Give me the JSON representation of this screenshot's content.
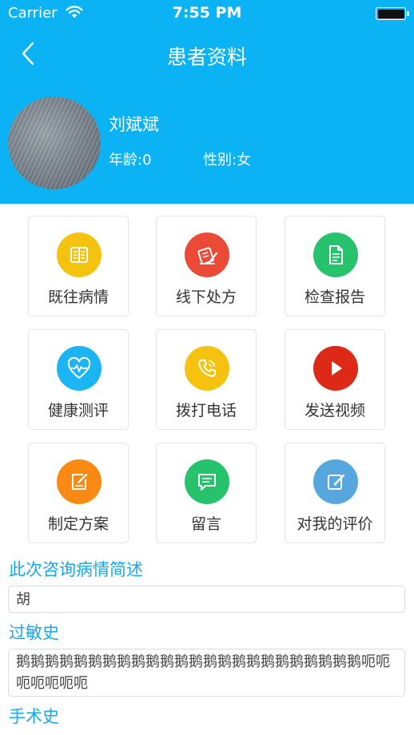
{
  "status_bar": {
    "carrier": "Carrier",
    "time": "7:55 PM"
  },
  "nav": {
    "title": "患者资料"
  },
  "patient": {
    "name": "刘斌斌",
    "age": "年龄:0",
    "gender": "性别:女"
  },
  "menu": [
    {
      "label": "既往病情",
      "icon": "book-icon",
      "color": "#f5c20f"
    },
    {
      "label": "线下处方",
      "icon": "prescription-icon",
      "color": "#ea4a36"
    },
    {
      "label": "检查报告",
      "icon": "report-document-icon",
      "color": "#27c26c"
    },
    {
      "label": "健康测评",
      "icon": "heart-pulse-icon",
      "color": "#1ab5f2"
    },
    {
      "label": "拨打电话",
      "icon": "phone-icon",
      "color": "#f5c20f"
    },
    {
      "label": "发送视频",
      "icon": "play-icon",
      "color": "#dd2a18"
    },
    {
      "label": "制定方案",
      "icon": "edit-plan-icon",
      "color": "#fa8a14"
    },
    {
      "label": "留言",
      "icon": "message-icon",
      "color": "#27c26c"
    },
    {
      "label": "对我的评价",
      "icon": "review-icon",
      "color": "#56a7dd"
    }
  ],
  "sections": {
    "consult_title": "此次咨询病情简述",
    "consult_value": "胡",
    "allergy_title": "过敏史",
    "allergy_value": "鹅鹅鹅鹅鹅鹅鹅鹅鹅鹅鹅鹅鹅鹅鹅鹅鹅鹅鹅鹅鹅鹅鹅鹅呃呃呃呃呃呃呃",
    "surgery_title": "手术史"
  }
}
